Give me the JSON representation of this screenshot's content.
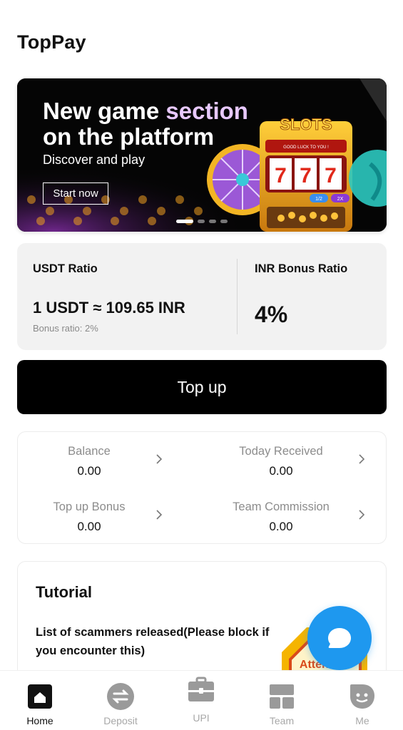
{
  "app": {
    "title": "TopPay"
  },
  "banner": {
    "title_line1_a": "New game ",
    "title_line1_b": "section",
    "title_line2": "on the platform",
    "subtitle": "Discover and play",
    "cta": "Start now",
    "slots_label": "SLOTS",
    "slots_tagline": "GOOD LUCK TO YOU !",
    "reels": [
      "7",
      "7",
      "7"
    ],
    "chip_left": "1/2",
    "chip_right": "2X",
    "slide_count": 4,
    "active_slide": 1
  },
  "ratio": {
    "usdt_label": "USDT Ratio",
    "usdt_value": "1 USDT ≈ 109.65 INR",
    "bonus_note": "Bonus ratio: 2%",
    "inr_label": "INR Bonus Ratio",
    "inr_value": "4%"
  },
  "topup": {
    "label": "Top up"
  },
  "stats": [
    {
      "label": "Balance",
      "value": "0.00"
    },
    {
      "label": "Today Received",
      "value": "0.00"
    },
    {
      "label": "Top up Bonus",
      "value": "0.00"
    },
    {
      "label": "Team Commission",
      "value": "0.00"
    }
  ],
  "tutorial": {
    "title": "Tutorial",
    "item": "List of scammers released(Please block if you encounter this)",
    "thumb_text": "Attention"
  },
  "nav": [
    {
      "label": "Home",
      "icon": "home-icon",
      "active": true
    },
    {
      "label": "Deposit",
      "icon": "exchange-icon",
      "active": false
    },
    {
      "label": "UPI",
      "icon": "briefcase-icon",
      "active": false
    },
    {
      "label": "Team",
      "icon": "team-grid-icon",
      "active": false
    },
    {
      "label": "Me",
      "icon": "profile-face-icon",
      "active": false
    }
  ],
  "colors": {
    "accent": "#1e98ef",
    "primary_button": "#000000",
    "card_bg": "#f2f2f2",
    "muted_text": "#8c8c8c"
  }
}
